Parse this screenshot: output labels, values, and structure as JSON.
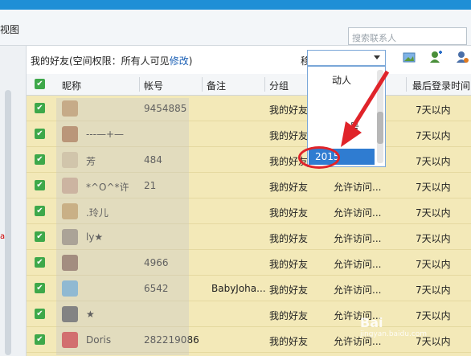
{
  "toolbar": {
    "view_label": "视图",
    "search_placeholder": "搜索联系人"
  },
  "infobar": {
    "label_prefix": "我的好友(空间权限：所有人可见",
    "edit_link": "修改",
    "label_suffix": ")",
    "move_to_label": "移动到"
  },
  "columns": [
    "昵称",
    "帐号",
    "备注",
    "分组",
    "",
    "最后登录时间"
  ],
  "dropdown": {
    "items": [
      "动人",
      "号"
    ],
    "selected": "2015"
  },
  "rows": [
    {
      "nick": "",
      "account": "9454885",
      "remark": "",
      "group": "我的好友",
      "access": "",
      "last_login": "7天以内"
    },
    {
      "nick": "---—+—",
      "account": "",
      "remark": "",
      "group": "我的好友",
      "access": "",
      "last_login": "7天以内"
    },
    {
      "nick": "芳",
      "account": "484",
      "remark": "",
      "group": "我的好友",
      "access": "",
      "last_login": "7天以内"
    },
    {
      "nick": "*^O^*许",
      "account": "21",
      "remark": "",
      "group": "我的好友",
      "access": "允许访问...",
      "last_login": "7天以内"
    },
    {
      "nick": ".玲儿",
      "account": "",
      "remark": "",
      "group": "我的好友",
      "access": "允许访问...",
      "last_login": "7天以内"
    },
    {
      "nick": "ly★",
      "account": "",
      "remark": "",
      "group": "我的好友",
      "access": "允许访问...",
      "last_login": "7天以内"
    },
    {
      "nick": "",
      "account": "4966",
      "remark": "",
      "group": "我的好友",
      "access": "允许访问...",
      "last_login": "7天以内"
    },
    {
      "nick": "",
      "account": "6542",
      "remark": "BabyJoha...",
      "group": "我的好友",
      "access": "允许访问...",
      "last_login": "7天以内"
    },
    {
      "nick": "★",
      "account": "",
      "remark": "",
      "group": "我的好友",
      "access": "允许访问...",
      "last_login": "7天以内"
    },
    {
      "nick": "Doris",
      "account": "282219086",
      "remark": "",
      "group": "我的好友",
      "access": "允许访问...",
      "last_login": "7天以内"
    }
  ],
  "watermark": {
    "brand": "Bai",
    "sub": "jingyan.baidu.com"
  }
}
